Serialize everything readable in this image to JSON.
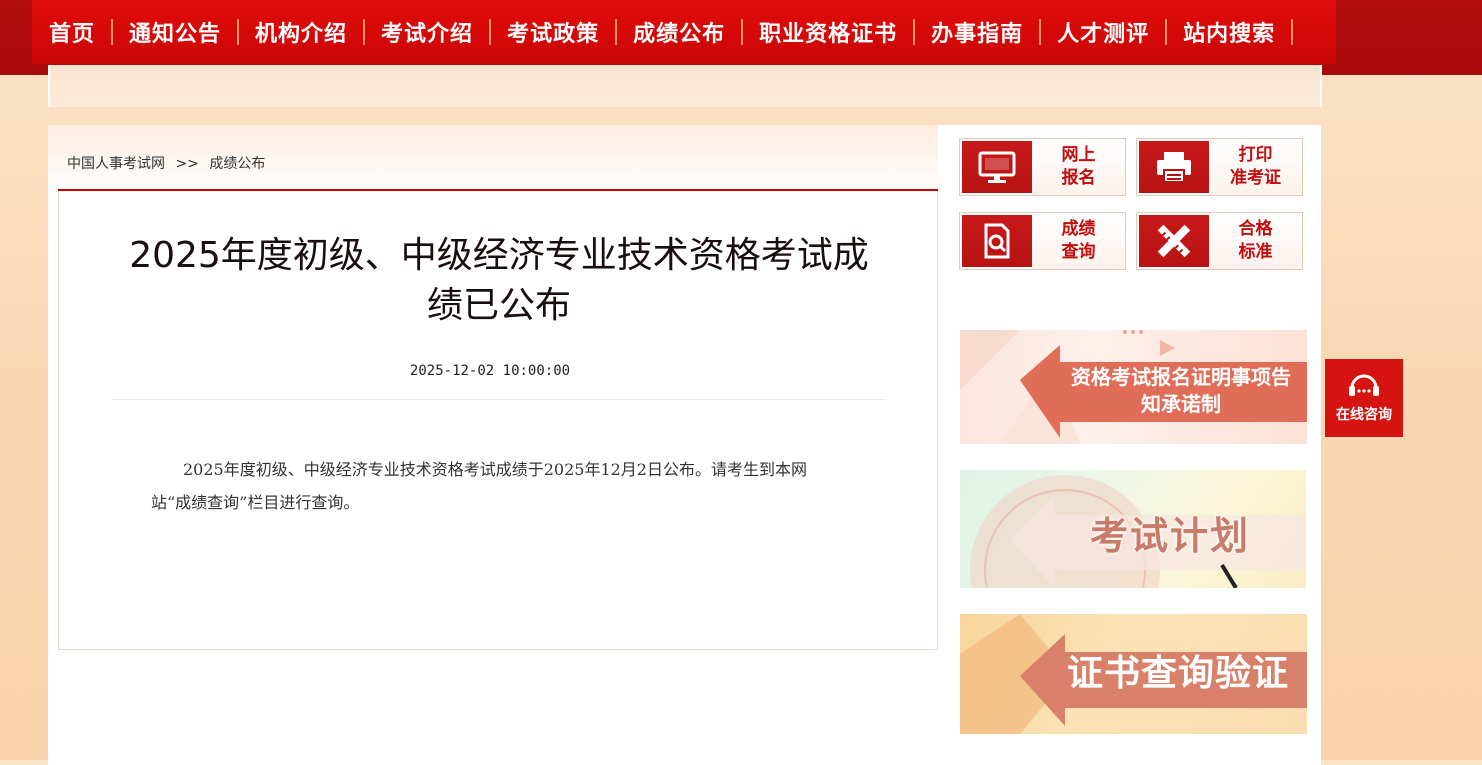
{
  "nav": {
    "items": [
      {
        "label": "首页"
      },
      {
        "label": "通知公告"
      },
      {
        "label": "机构介绍"
      },
      {
        "label": "考试介绍"
      },
      {
        "label": "考试政策"
      },
      {
        "label": "成绩公布"
      },
      {
        "label": "职业资格证书"
      },
      {
        "label": "办事指南"
      },
      {
        "label": "人才测评"
      },
      {
        "label": "站内搜索"
      }
    ]
  },
  "breadcrumb": {
    "home": "中国人事考试网",
    "separator": ">>",
    "current": "成绩公布"
  },
  "article": {
    "title": "2025年度初级、中级经济专业技术资格考试成绩已公布",
    "date": "2025-12-02 10:00:00",
    "body": "2025年度初级、中级经济专业技术资格考试成绩于2025年12月2日公布。请考生到本网站“成绩查询”栏目进行查询。"
  },
  "quick_links": [
    {
      "label": "网上\n报名",
      "icon": "monitor-icon"
    },
    {
      "label": "打印\n准考证",
      "icon": "printer-icon"
    },
    {
      "label": "成绩\n查询",
      "icon": "search-document-icon"
    },
    {
      "label": "合格\n标准",
      "icon": "ruler-pencil-icon"
    }
  ],
  "banners": {
    "commitment": "资格考试报名证明事项告知承诺制",
    "exam_plan": "考试计划",
    "certificate": "证书查询验证"
  },
  "consult": {
    "label": "在线咨询",
    "icon": "headset-icon"
  },
  "colors": {
    "nav_red": "#d40808",
    "brand_red": "#c20e0e",
    "consult_red": "#d51412"
  }
}
